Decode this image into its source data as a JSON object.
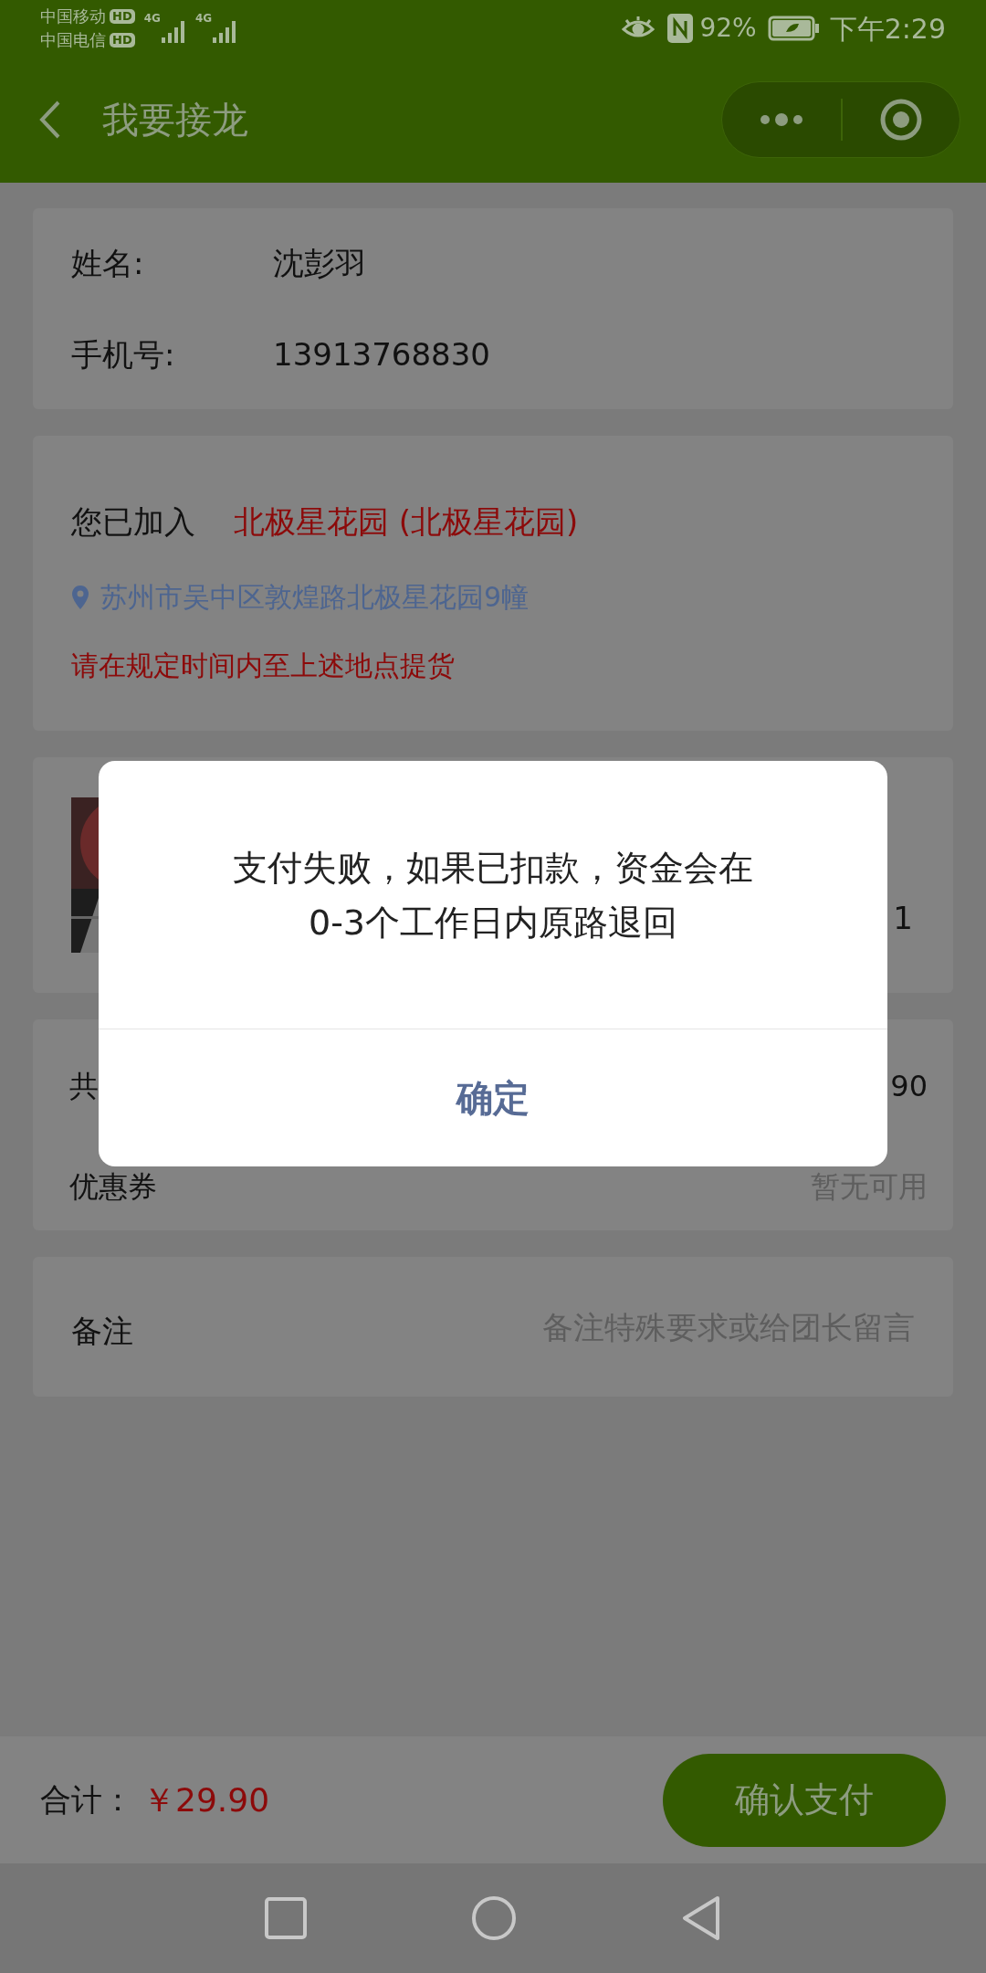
{
  "status_bar": {
    "carriers": [
      {
        "name": "中国移动",
        "badge": "HD"
      },
      {
        "name": "中国电信",
        "badge": "HD"
      }
    ],
    "networks": [
      "4G",
      "4G"
    ],
    "battery": "92%",
    "time": "下午2:29"
  },
  "nav": {
    "title": "我要接龙"
  },
  "contact": {
    "fields": [
      {
        "label": "姓名:",
        "value": "沈彭羽"
      },
      {
        "label": "手机号:",
        "value": "13913768830"
      }
    ]
  },
  "pickup": {
    "label": "您已加入",
    "community": "北极星花园 (北极星花园)",
    "address": "苏州市吴中区敦煌路北极星花园9幢",
    "note": "请在规定时间内至上述地点提货"
  },
  "product": {
    "quantity": "1"
  },
  "summary": {
    "rows": [
      {
        "label": "共",
        "value": "90"
      },
      {
        "label": "优惠券",
        "value": "暂无可用"
      }
    ]
  },
  "remark": {
    "label": "备注",
    "placeholder": "备注特殊要求或给团长留言"
  },
  "footer": {
    "total_label": "合计：",
    "total": "￥29.90",
    "pay_button": "确认支付"
  },
  "dialog": {
    "message": "支付失败，如果已扣款，资金会在0-3个工作日内原路退回",
    "button": "确定"
  }
}
